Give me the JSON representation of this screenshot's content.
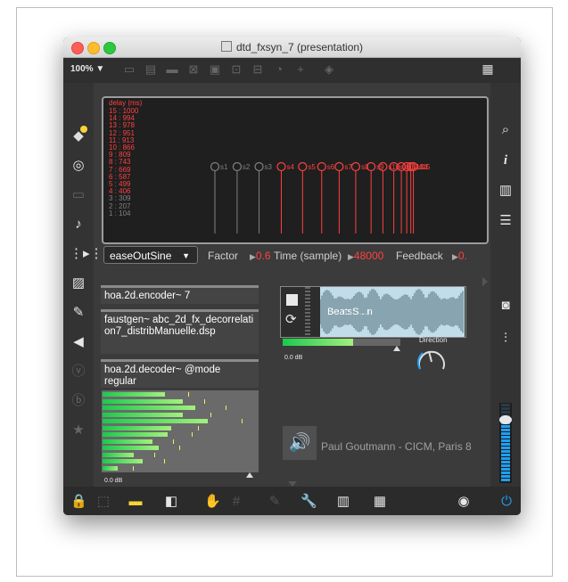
{
  "window": {
    "title": "dtd_fxsyn_7 (presentation)",
    "zoom": "100%",
    "zoom_arrow": "▼"
  },
  "colors": {
    "active_red": "#ff4040",
    "inactive_gray": "#808080",
    "accent_blue": "#1e9ff2",
    "meter_green": "#1bc94d",
    "lock_yellow": "#f8d33a"
  },
  "toolbar_icons": [
    "line-icon",
    "comment-box-icon",
    "speech-bubble-icon",
    "close-box-icon",
    "object-icon",
    "inlet-icon",
    "outlet-icon",
    "gauge-icon",
    "plus-icon",
    "paint-bucket-icon"
  ],
  "left_sidebar_icons": [
    "cube-icon",
    "target-icon",
    "layout-icon",
    "music-note-icon",
    "segment-icon",
    "image-icon",
    "paperclip-icon",
    "plug-icon",
    "v-badge-icon",
    "b-badge-icon",
    "star-icon"
  ],
  "right_sidebar_icons": [
    "search-icon",
    "info-icon",
    "columns-icon",
    "list-icon",
    "camera-icon",
    "sliders-icon"
  ],
  "bottom_icons": [
    "lock-icon",
    "cursor-icon",
    "presentation-icon",
    "window-icon",
    "hand-icon",
    "grid-icon",
    "debug-icon",
    "wrench-icon",
    "piano-icon",
    "keyboard-icon",
    "play-icon",
    "power-icon"
  ],
  "delay_panel": {
    "title": "delay (ms)",
    "entries": [
      {
        "text": "15 : 1000",
        "active": true
      },
      {
        "text": "14 : 994",
        "active": true
      },
      {
        "text": "13 : 978",
        "active": true
      },
      {
        "text": "12 : 951",
        "active": true
      },
      {
        "text": "11 : 913",
        "active": true
      },
      {
        "text": "10 : 866",
        "active": true
      },
      {
        "text": "9 : 809",
        "active": true
      },
      {
        "text": "8 : 743",
        "active": true
      },
      {
        "text": "7 : 669",
        "active": true
      },
      {
        "text": "6 : 587",
        "active": true
      },
      {
        "text": "5 : 499",
        "active": true
      },
      {
        "text": "4 : 406",
        "active": true
      },
      {
        "text": "3 : 309",
        "active": false
      },
      {
        "text": "2 : 207",
        "active": false
      },
      {
        "text": "1 : 104",
        "active": false
      }
    ],
    "markers": [
      {
        "label": "s1",
        "active": false,
        "pos": 0.0
      },
      {
        "label": "s2",
        "active": false,
        "pos": 0.094
      },
      {
        "label": "s3",
        "active": false,
        "pos": 0.187
      },
      {
        "label": "s4",
        "active": true,
        "pos": 0.281
      },
      {
        "label": "s5",
        "active": true,
        "pos": 0.371
      },
      {
        "label": "s6",
        "active": true,
        "pos": 0.452
      },
      {
        "label": "s7",
        "active": true,
        "pos": 0.526
      },
      {
        "label": "s8",
        "active": true,
        "pos": 0.596
      },
      {
        "label": "s9",
        "active": true,
        "pos": 0.661
      },
      {
        "label": "s10",
        "active": true,
        "pos": 0.711
      },
      {
        "label": "s11",
        "active": true,
        "pos": 0.757
      },
      {
        "label": "s12",
        "active": true,
        "pos": 0.789
      },
      {
        "label": "s13",
        "active": true,
        "pos": 0.812
      },
      {
        "label": "s14",
        "active": true,
        "pos": 0.829
      },
      {
        "label": "s15",
        "active": true,
        "pos": 0.84
      }
    ]
  },
  "controls": {
    "easing": "easeOutSine",
    "factor_label": "Factor",
    "factor_value": "0.6",
    "time_label": "Time (sample)",
    "time_value": "48000",
    "feedback_label": "Feedback",
    "feedback_value": "0."
  },
  "objects": [
    {
      "text": "hoa.2d.encoder~ 7"
    },
    {
      "text": "faustgen~ abc_2d_fx_decorrelation7_distribManuelle.dsp"
    },
    {
      "text": "hoa.2d.decoder~ @mode regular"
    }
  ],
  "meters": {
    "levels": [
      0.4,
      0.52,
      0.6,
      0.52,
      0.68,
      0.44,
      0.42,
      0.32,
      0.36,
      0.2,
      0.26,
      0.1
    ],
    "peaks": [
      0.56,
      0.66,
      0.8,
      0.7,
      0.9,
      0.62,
      0.58,
      0.46,
      0.5,
      0.34,
      0.4,
      0.2
    ],
    "db_label": "0.0 dB"
  },
  "sampler": {
    "name": "BeatsS...n",
    "level": 0.6,
    "db_label": "0.0 dB",
    "direction_label": "Direction"
  },
  "credit": "Paul Goutmann - CICM, Paris 8",
  "master_level": 0.8
}
